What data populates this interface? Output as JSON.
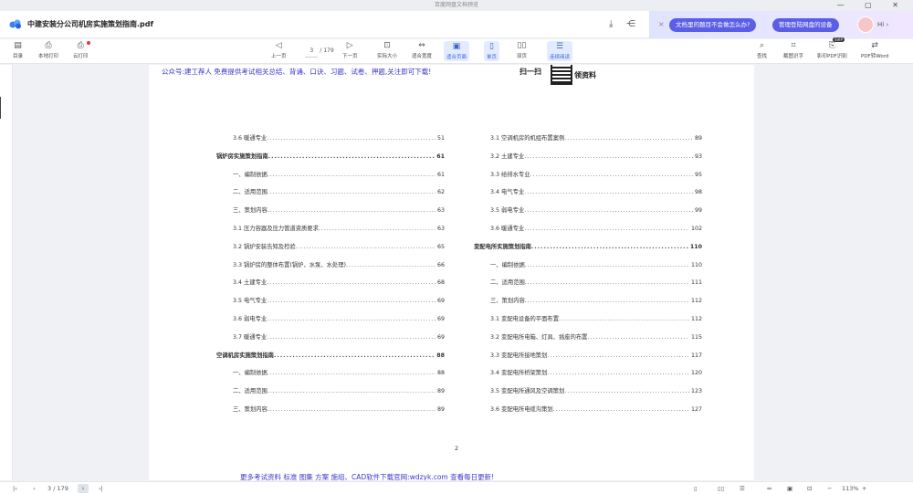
{
  "app": {
    "window_title": "百度网盘文档预览"
  },
  "header": {
    "doc_title": "中建安装分公司机房实施策划指南.pdf"
  },
  "promo": {
    "close": "×",
    "question": "文档里的题目不会做怎么办?",
    "manage": "管理登陆网盘的设备",
    "greeting": "Hi"
  },
  "toolbar": {
    "catalog": "目录",
    "local_print": "本地打印",
    "cloud_print": "云打印",
    "prev": "上一页",
    "page_current": "3",
    "page_total": "/ 179",
    "next": "下一页",
    "actual_size": "实际大小",
    "fit_width": "适合宽度",
    "fit_page": "适合页面",
    "single": "单页",
    "double": "双页",
    "continuous": "连续阅读",
    "find": "查找",
    "screenshot_ocr": "截图识字",
    "pdf_print": "影印PDF识别",
    "svip": "SVIP",
    "pdf_word": "PDF转Word"
  },
  "page": {
    "header_text": "公众号:建工荐人 免费提供考试相关总结、背诵、口诀、习题、试卷、押题,关注即可下载!",
    "brand_left": "扫一扫",
    "brand_right": "领资料",
    "page_number": "2",
    "footer_text": "更多考试资料 标准 图集 方案 施组、CAD软件下载官网:wdzyk.com 查看每日更新!"
  },
  "toc_left": [
    {
      "t": "3.6 暖通专业",
      "p": "51",
      "indent": true
    },
    {
      "t": "锅炉房实施策划指南",
      "p": "61",
      "bold": true
    },
    {
      "t": "一、编制依据",
      "p": "61",
      "indent": true
    },
    {
      "t": "二、适用范围",
      "p": "62",
      "indent": true
    },
    {
      "t": "三、策划内容",
      "p": "63",
      "indent": true
    },
    {
      "t": "3.1 压力容器及压力管道资质要求",
      "p": "63",
      "indent": true
    },
    {
      "t": "3.2 锅炉安装告知及检验",
      "p": "65",
      "indent": true
    },
    {
      "t": "3.3 锅炉房的整体布置(锅炉、水泵、水处理)",
      "p": "66",
      "indent": true
    },
    {
      "t": "3.4 土建专业",
      "p": "68",
      "indent": true
    },
    {
      "t": "3.5 电气专业",
      "p": "69",
      "indent": true
    },
    {
      "t": "3.6 弱电专业",
      "p": "69",
      "indent": true
    },
    {
      "t": "3.7 暖通专业",
      "p": "69",
      "indent": true
    },
    {
      "t": "空调机房实施策划指南",
      "p": "88",
      "bold": true
    },
    {
      "t": "一、编制依据",
      "p": "88",
      "indent": true
    },
    {
      "t": "二、适用范围",
      "p": "89",
      "indent": true
    },
    {
      "t": "三、策划内容",
      "p": "89",
      "indent": true
    }
  ],
  "toc_right": [
    {
      "t": "3.1 空调机房的机组布置案例",
      "p": "89",
      "indent": true
    },
    {
      "t": "3.2 土建专业",
      "p": "93",
      "indent": true
    },
    {
      "t": "3.3 给排水专业",
      "p": "95",
      "indent": true
    },
    {
      "t": "3.4 电气专业",
      "p": "98",
      "indent": true
    },
    {
      "t": "3.5 弱电专业",
      "p": "99",
      "indent": true
    },
    {
      "t": "3.6 暖通专业",
      "p": "102",
      "indent": true
    },
    {
      "t": "变配电所实施策划指南",
      "p": "110",
      "bold": true
    },
    {
      "t": "一、编制依据",
      "p": "110",
      "indent": true
    },
    {
      "t": "二、适用范围",
      "p": "111",
      "indent": true
    },
    {
      "t": "三、策划内容",
      "p": "112",
      "indent": true
    },
    {
      "t": "3.1 变配电设备的平面布置",
      "p": "112",
      "indent": true
    },
    {
      "t": "3.2 变配电所电箱、灯具、插座的布置",
      "p": "115",
      "indent": true
    },
    {
      "t": "3.3 变配电所接地策划",
      "p": "117",
      "indent": true
    },
    {
      "t": "3.4 变配电所桥架策划",
      "p": "120",
      "indent": true
    },
    {
      "t": "3.5 变配电所通风及空调策划",
      "p": "123",
      "indent": true
    },
    {
      "t": "3.6 变配电所电缆沟策划",
      "p": "127",
      "indent": true
    }
  ],
  "status": {
    "page_current": "3",
    "page_total": "/ 179",
    "zoom": "113%"
  }
}
